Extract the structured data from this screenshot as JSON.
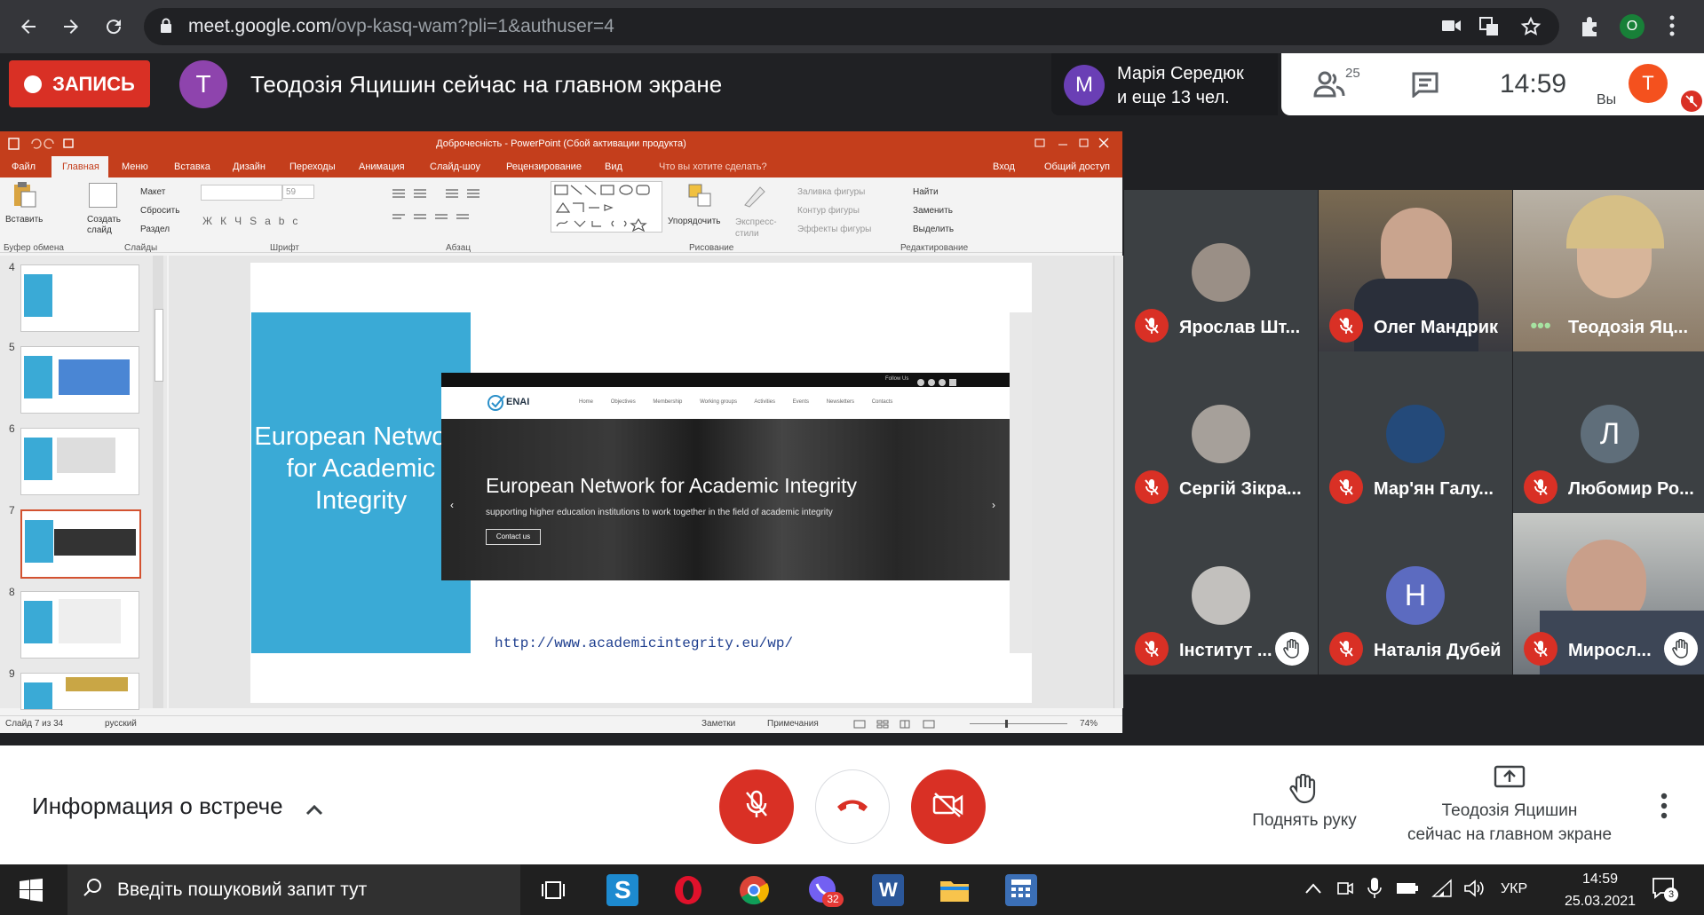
{
  "browser": {
    "url_host": "meet.google.com",
    "url_path": "/ovp-kasq-wam?pli=1&authuser=4",
    "profile_letter": "O"
  },
  "meet_header": {
    "record_label": "ЗАПИСЬ",
    "presenter_initial": "T",
    "presenting_text": "Теодозія Яцишин сейчас на главном экране",
    "owner_initial": "M",
    "owner_line1": "Марія Середюк",
    "owner_line2": "и еще 13 чел.",
    "people_count": "25",
    "clock": "14:59",
    "you_initial": "T",
    "you_label": "Вы"
  },
  "powerpoint": {
    "title": "Доброчесність - PowerPoint (Сбой активации продукта)",
    "tabs": [
      "Файл",
      "Главная",
      "Меню",
      "Вставка",
      "Дизайн",
      "Переходы",
      "Анимация",
      "Слайд-шоу",
      "Рецензирование",
      "Вид",
      "Что вы хотите сделать?"
    ],
    "signin": "Вход",
    "share": "Общий доступ",
    "ribbon": {
      "paste": "Вставить",
      "create_slide": "Создать слайд",
      "layout": "Макет",
      "reset": "Сбросить",
      "section": "Раздел",
      "font_size": "59",
      "arrange": "Упорядочить",
      "express_styles": "Экспресс-стили",
      "shape_fill": "Заливка фигуры",
      "shape_outline": "Контур фигуры",
      "shape_effects": "Эффекты фигуры",
      "find": "Найти",
      "replace": "Заменить",
      "select": "Выделить"
    },
    "ribbon_groups": [
      "Буфер обмена",
      "Слайды",
      "Шрифт",
      "Абзац",
      "Рисование",
      "Редактирование"
    ],
    "thumb_numbers": [
      "4",
      "5",
      "6",
      "7",
      "8",
      "9"
    ],
    "selected_thumb": "7",
    "slide": {
      "left_title": "European Network for Academic Integrity",
      "site_logo": "ENAI",
      "site_nav": [
        "Home",
        "Objectives",
        "Membership",
        "Working groups",
        "Activities",
        "Events",
        "Newsletters",
        "Contacts"
      ],
      "follow": "Follow Us",
      "hero_title": "European Network for Academic Integrity",
      "hero_sub": "supporting higher education institutions to work together in the field of academic integrity",
      "hero_button": "Contact us",
      "link": "http://www.academicintegrity.eu/wp/"
    },
    "status": {
      "slide_info": "Слайд 7 из 34",
      "language": "русский",
      "notes": "Заметки",
      "comments": "Примечания",
      "zoom": "74%"
    }
  },
  "participants": [
    {
      "name": "Ярослав Шт...",
      "type": "photo",
      "hand": false
    },
    {
      "name": "Олег Мандрик",
      "type": "video",
      "hand": false
    },
    {
      "name": "Теодозія Яц...",
      "type": "video",
      "hand": false,
      "speaking": true
    },
    {
      "name": "Сергій Зікра...",
      "type": "photo",
      "hand": false
    },
    {
      "name": "Мар'ян Галу...",
      "type": "photo",
      "hand": false
    },
    {
      "name": "Любомир Ро...",
      "type": "letter",
      "letter": "Л",
      "hand": false
    },
    {
      "name": "Інститут ...",
      "type": "photo",
      "hand": true
    },
    {
      "name": "Наталія Дубей",
      "type": "letter",
      "letter": "Н",
      "hand": false
    },
    {
      "name": "Миросл...",
      "type": "video",
      "hand": true
    }
  ],
  "controls": {
    "meeting_info": "Информация о встрече",
    "raise_hand": "Поднять руку",
    "present_line1": "Теодозія Яцишин",
    "present_line2": "сейчас на главном экране"
  },
  "taskbar": {
    "search_placeholder": "Введіть пошуковий запит тут",
    "viber_badge": "32",
    "language": "УКР",
    "time": "14:59",
    "date": "25.03.2021",
    "notif_count": "3"
  },
  "colors": {
    "meet_red": "#d93025",
    "ppt_orange": "#c43e1c",
    "slide_blue": "#3aaad6",
    "presenter_purple": "#8e44ad",
    "you_orange": "#f4511e"
  }
}
